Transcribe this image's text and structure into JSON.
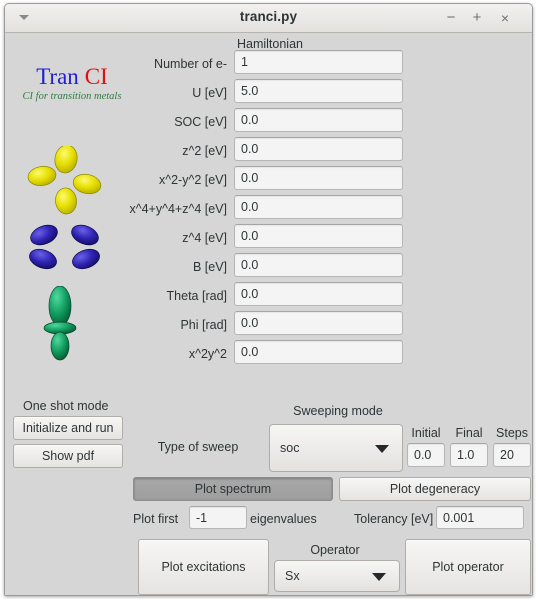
{
  "window": {
    "title": "tranci.py",
    "menu_icon": "chevron-down-icon",
    "minimize_label": "−",
    "maximize_label": "+",
    "close_label": "×"
  },
  "logo": {
    "part1": "Tran",
    "part2": "CI",
    "subtitle": "CI for transition metals",
    "part1_color": "#2020d8",
    "part2_color": "#e01010",
    "subtitle_color": "#2f7d42",
    "orbitals": [
      {
        "name": "d-orbital-yellow",
        "color": "#e8e000"
      },
      {
        "name": "d-orbital-blue",
        "color": "#2a1fb0"
      },
      {
        "name": "dz2-orbital-green",
        "color": "#119c5e"
      }
    ]
  },
  "hamiltonian": {
    "heading": "Hamiltonian",
    "fields": [
      {
        "label": "Number of e-",
        "value": "1"
      },
      {
        "label": "U [eV]",
        "value": "5.0"
      },
      {
        "label": "SOC [eV]",
        "value": "0.0"
      },
      {
        "label": "z^2 [eV]",
        "value": "0.0"
      },
      {
        "label": "x^2-y^2 [eV]",
        "value": "0.0"
      },
      {
        "label": "x^4+y^4+z^4 [eV]",
        "value": "0.0"
      },
      {
        "label": "z^4 [eV]",
        "value": "0.0"
      },
      {
        "label": "B [eV]",
        "value": "0.0"
      },
      {
        "label": "Theta [rad]",
        "value": "0.0"
      },
      {
        "label": "Phi [rad]",
        "value": "0.0"
      },
      {
        "label": "x^2y^2",
        "value": "0.0"
      }
    ]
  },
  "one_shot": {
    "heading": "One shot mode",
    "initialize_label": "Initialize and run",
    "show_pdf_label": "Show pdf"
  },
  "sweeping": {
    "heading": "Sweeping mode",
    "type_label": "Type of sweep",
    "selected": "soc",
    "options": [
      "soc"
    ],
    "initial_label": "Initial",
    "initial_value": "0.0",
    "final_label": "Final",
    "final_value": "1.0",
    "steps_label": "Steps",
    "steps_value": "20"
  },
  "plots": {
    "plot_spectrum_label": "Plot spectrum",
    "plot_degeneracy_label": "Plot degeneracy",
    "plot_first_label": "Plot first",
    "plot_first_value": "-1",
    "eigenvalues_label": "eigenvalues",
    "tolerancy_label": "Tolerancy [eV]",
    "tolerancy_value": "0.001"
  },
  "operator_section": {
    "plot_excitations_label": "Plot excitations",
    "operator_label": "Operator",
    "operator_selected": "Sx",
    "operator_options": [
      "Sx"
    ],
    "plot_operator_label": "Plot operator"
  }
}
